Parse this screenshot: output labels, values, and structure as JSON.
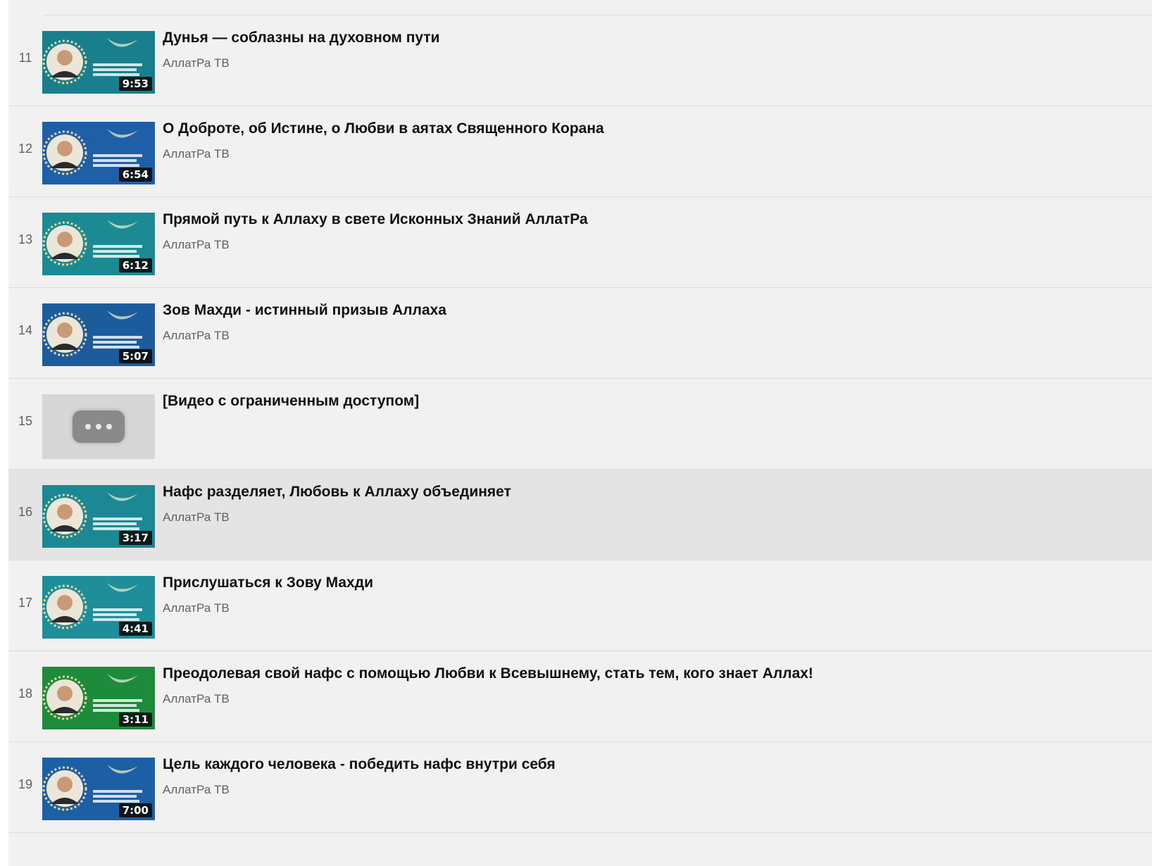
{
  "playlist": {
    "items": [
      {
        "index": "11",
        "title": "Дунья — соблазны на духовном пути",
        "channel": "АллатРа ТВ",
        "duration": "9:53",
        "bg": "#1a7f8c",
        "available": true
      },
      {
        "index": "12",
        "title": "О Доброте, об Истине, о Любви в аятах Священного Корана",
        "channel": "АллатРа ТВ",
        "duration": "6:54",
        "bg": "#1e5fa8",
        "available": true
      },
      {
        "index": "13",
        "title": "Прямой путь к Аллаху в свете Исконных Знаний АллатРа",
        "channel": "АллатРа ТВ",
        "duration": "6:12",
        "bg": "#1b8a93",
        "available": true
      },
      {
        "index": "14",
        "title": "Зов Махди - истинный призыв Аллаха",
        "channel": "АллатРа ТВ",
        "duration": "5:07",
        "bg": "#1d5c9c",
        "available": true
      },
      {
        "index": "15",
        "title": "[Видео с ограниченным доступом]",
        "channel": "",
        "duration": "",
        "bg": "#d7d7d7",
        "available": false
      },
      {
        "index": "16",
        "title": "Нафс разделяет, Любовь к Аллаху объединяет",
        "channel": "АллатРа ТВ",
        "duration": "3:17",
        "bg": "#1b8893",
        "available": true,
        "active": true
      },
      {
        "index": "17",
        "title": "Прислушаться к Зову Махди",
        "channel": "АллатРа ТВ",
        "duration": "4:41",
        "bg": "#1d8e9a",
        "available": true
      },
      {
        "index": "18",
        "title": "Преодолевая свой нафс с помощью Любви к Всевышнему, стать тем, кого знает Аллах!",
        "channel": "АллатРа ТВ",
        "duration": "3:11",
        "bg": "#1e8a3c",
        "available": true
      },
      {
        "index": "19",
        "title": "Цель каждого человека - победить нафс внутри себя",
        "channel": "АллатРа ТВ",
        "duration": "7:00",
        "bg": "#1d5fa5",
        "available": true
      }
    ]
  }
}
